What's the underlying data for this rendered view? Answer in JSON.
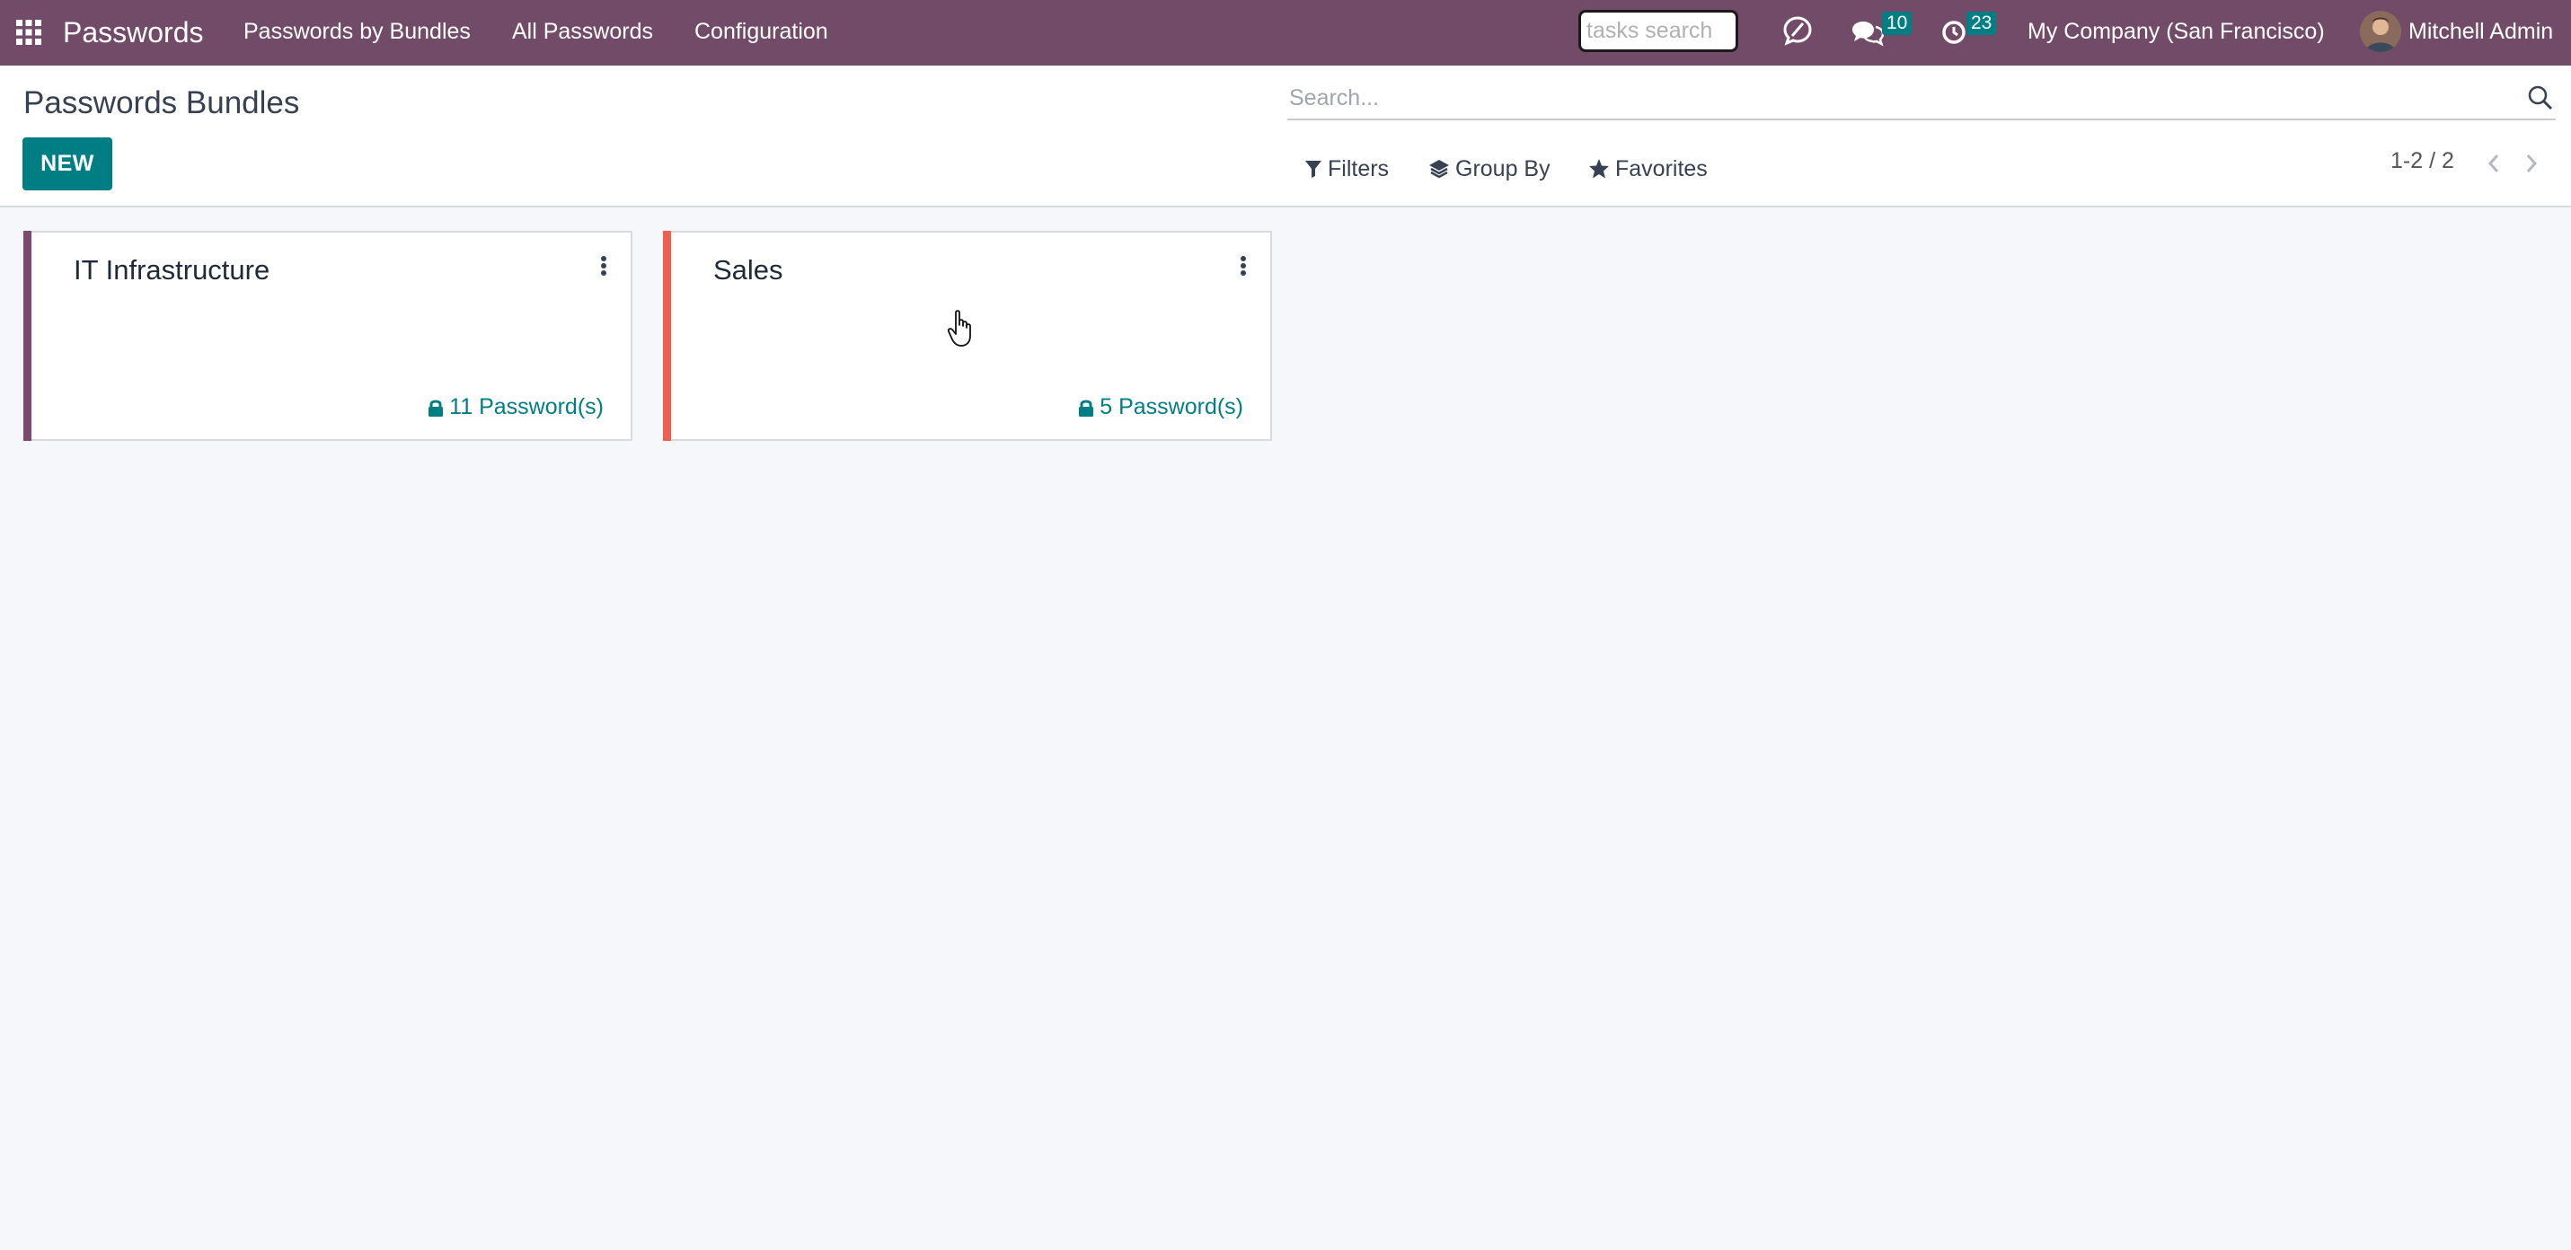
{
  "navbar": {
    "app_name": "Passwords",
    "menu": [
      "Passwords by Bundles",
      "All Passwords",
      "Configuration"
    ],
    "tasks_search_placeholder": "tasks search",
    "messages_badge": "10",
    "activities_badge": "23",
    "company": "My Company (San Francisco)",
    "user": "Mitchell Admin",
    "background_color": "#714b67"
  },
  "control_panel": {
    "title": "Passwords Bundles",
    "new_label": "NEW",
    "search_placeholder": "Search...",
    "filters_label": "Filters",
    "group_by_label": "Group By",
    "favorites_label": "Favorites",
    "pager": "1-2 / 2",
    "accent_color": "#017e84"
  },
  "cards": [
    {
      "title": "IT Infrastructure",
      "count_label": "11 Password(s)",
      "color": "#7c4a6e"
    },
    {
      "title": "Sales",
      "count_label": "5 Password(s)",
      "color": "#f06050"
    }
  ]
}
